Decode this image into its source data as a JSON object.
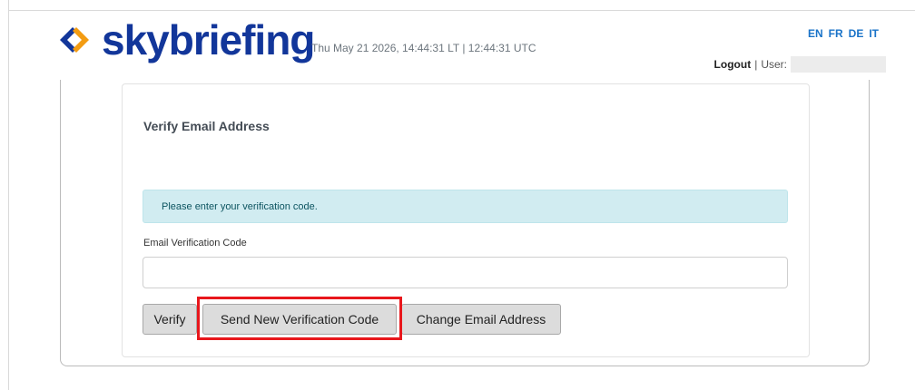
{
  "header": {
    "logo_text": "skybriefing",
    "datetime": "Thu May 21 2026, 14:44:31 LT | 12:44:31 UTC",
    "languages": [
      "EN",
      "FR",
      "DE",
      "IT"
    ],
    "logout_label": "Logout",
    "separator": "|",
    "user_label": "User:"
  },
  "colors": {
    "brand": "#12369a",
    "logo_orange": "#f39c12",
    "highlight": "#e8171c",
    "alert_bg": "#d1ecf1"
  },
  "main": {
    "card_title": "Verify Email Address",
    "alert_text": "Please enter your verification code.",
    "code_label": "Email Verification Code",
    "code_value": "",
    "buttons": {
      "verify": "Verify",
      "resend": "Send New Verification Code",
      "change": "Change Email Address"
    }
  }
}
